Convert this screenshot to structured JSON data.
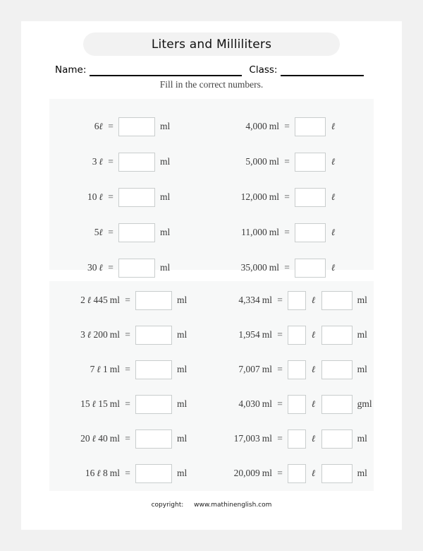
{
  "worksheet": {
    "title": "Liters and Milliliters",
    "name_label": "Name:",
    "class_label": "Class:",
    "instruction": "Fill in the correct numbers.",
    "equals": "=",
    "footer": {
      "copyright_label": "copyright:",
      "site": "www.mathinenglish.com"
    }
  },
  "units": {
    "ml": "ml",
    "liter": "ℓ",
    "gml": "gml"
  },
  "section_1": {
    "rows": [
      {
        "left": {
          "value": "6",
          "unit": "ℓ",
          "spaced": false,
          "answer_unit": "ml"
        },
        "right": {
          "value": "4,000",
          "unit": "ml",
          "answer_unit": "ℓ"
        }
      },
      {
        "left": {
          "value": "3",
          "unit": "ℓ",
          "spaced": true,
          "answer_unit": "ml"
        },
        "right": {
          "value": "5,000",
          "unit": "ml",
          "answer_unit": "ℓ"
        }
      },
      {
        "left": {
          "value": "10",
          "unit": "ℓ",
          "spaced": true,
          "answer_unit": "ml"
        },
        "right": {
          "value": "12,000",
          "unit": "ml",
          "answer_unit": "ℓ"
        }
      },
      {
        "left": {
          "value": "5",
          "unit": "ℓ",
          "spaced": false,
          "answer_unit": "ml"
        },
        "right": {
          "value": "11,000",
          "unit": "ml",
          "answer_unit": "ℓ"
        }
      },
      {
        "left": {
          "value": "30",
          "unit": "ℓ",
          "spaced": true,
          "answer_unit": "ml"
        },
        "right": {
          "value": "35,000",
          "unit": "ml",
          "answer_unit": "ℓ"
        }
      }
    ]
  },
  "section_2": {
    "rows": [
      {
        "left": {
          "liters": "2",
          "liter_unit": "ℓ",
          "milliliters": "445",
          "ml_unit": "ml",
          "answer_unit": "ml"
        },
        "right": {
          "value": "4,334",
          "unit": "ml",
          "answer_unit_1": "ℓ",
          "answer_unit_2": "ml"
        }
      },
      {
        "left": {
          "liters": "3",
          "liter_unit": "ℓ",
          "milliliters": "200",
          "ml_unit": "ml",
          "answer_unit": "ml"
        },
        "right": {
          "value": "1,954",
          "unit": "ml",
          "answer_unit_1": "ℓ",
          "answer_unit_2": "ml"
        }
      },
      {
        "left": {
          "liters": "7",
          "liter_unit": "ℓ",
          "milliliters": "1",
          "ml_unit": "ml",
          "answer_unit": "ml"
        },
        "right": {
          "value": "7,007",
          "unit": "ml",
          "answer_unit_1": "ℓ",
          "answer_unit_2": "ml"
        }
      },
      {
        "left": {
          "liters": "15",
          "liter_unit": "ℓ",
          "milliliters": "15",
          "ml_unit": "ml",
          "answer_unit": "ml"
        },
        "right": {
          "value": "4,030",
          "unit": "ml",
          "answer_unit_1": "ℓ",
          "answer_unit_2": "gml"
        }
      },
      {
        "left": {
          "liters": "20",
          "liter_unit": "ℓ",
          "milliliters": "40",
          "ml_unit": "ml",
          "answer_unit": "ml"
        },
        "right": {
          "value": "17,003",
          "unit": "ml",
          "answer_unit_1": "ℓ",
          "answer_unit_2": "ml"
        }
      },
      {
        "left": {
          "liters": "16",
          "liter_unit": "ℓ",
          "milliliters": "8",
          "ml_unit": "ml",
          "answer_unit": "ml"
        },
        "right": {
          "value": "20,009",
          "unit": "ml",
          "answer_unit_1": "ℓ",
          "answer_unit_2": "ml"
        }
      }
    ]
  }
}
